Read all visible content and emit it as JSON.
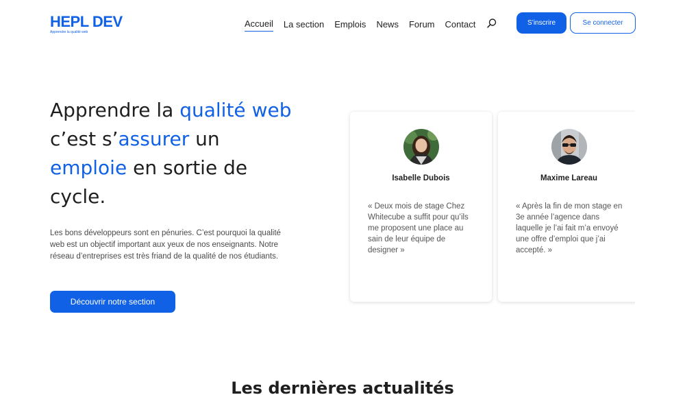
{
  "header": {
    "logo_title": "HEPL DEV",
    "logo_tagline": "Apprendre la qualité web",
    "nav": [
      {
        "label": "Accueil",
        "active": true
      },
      {
        "label": "La section",
        "active": false
      },
      {
        "label": "Emplois",
        "active": false
      },
      {
        "label": "News",
        "active": false
      },
      {
        "label": "Forum",
        "active": false
      },
      {
        "label": "Contact",
        "active": false
      }
    ],
    "search_icon": "search-icon",
    "signup_label": "S’inscrire",
    "login_label": "Se connecter"
  },
  "hero": {
    "title_parts": [
      {
        "text": "Apprendre la ",
        "accent": false
      },
      {
        "text": "qualité",
        "accent": true
      },
      {
        "text": " ",
        "accent": false
      },
      {
        "text": "web",
        "accent": true
      },
      {
        "text": " c’est s’",
        "accent": false
      },
      {
        "text": "assurer",
        "accent": true
      },
      {
        "text": " un ",
        "accent": false
      },
      {
        "text": "emploie",
        "accent": true
      },
      {
        "text": " en sortie de cycle.",
        "accent": false
      }
    ],
    "description": "Les bons développeurs sont en pénuries. C’est pourquoi la qualité web est un objectif important aux yeux de nos enseignants. Notre réseau d’entreprises est très friand de la qualité de nos étudiants.",
    "cta_label": "Découvrir notre section"
  },
  "testimonials": [
    {
      "name": "Isabelle Dubois",
      "quote": "« Deux mois de stage Chez Whitecube a suffit pour qu’ils me proposent une place au sain de leur équipe de designer »"
    },
    {
      "name": "Maxime Lareau",
      "quote": "« Après la fin de mon stage en 3e année l’agence dans laquelle je l’ai fait m’a envoyé une offre d’emploi que j’ai accepté. »"
    }
  ],
  "news": {
    "title": "Les dernières actualités"
  },
  "colors": {
    "accent": "#1061e6",
    "text": "#1f1f1f",
    "muted": "#4a4a4a"
  }
}
